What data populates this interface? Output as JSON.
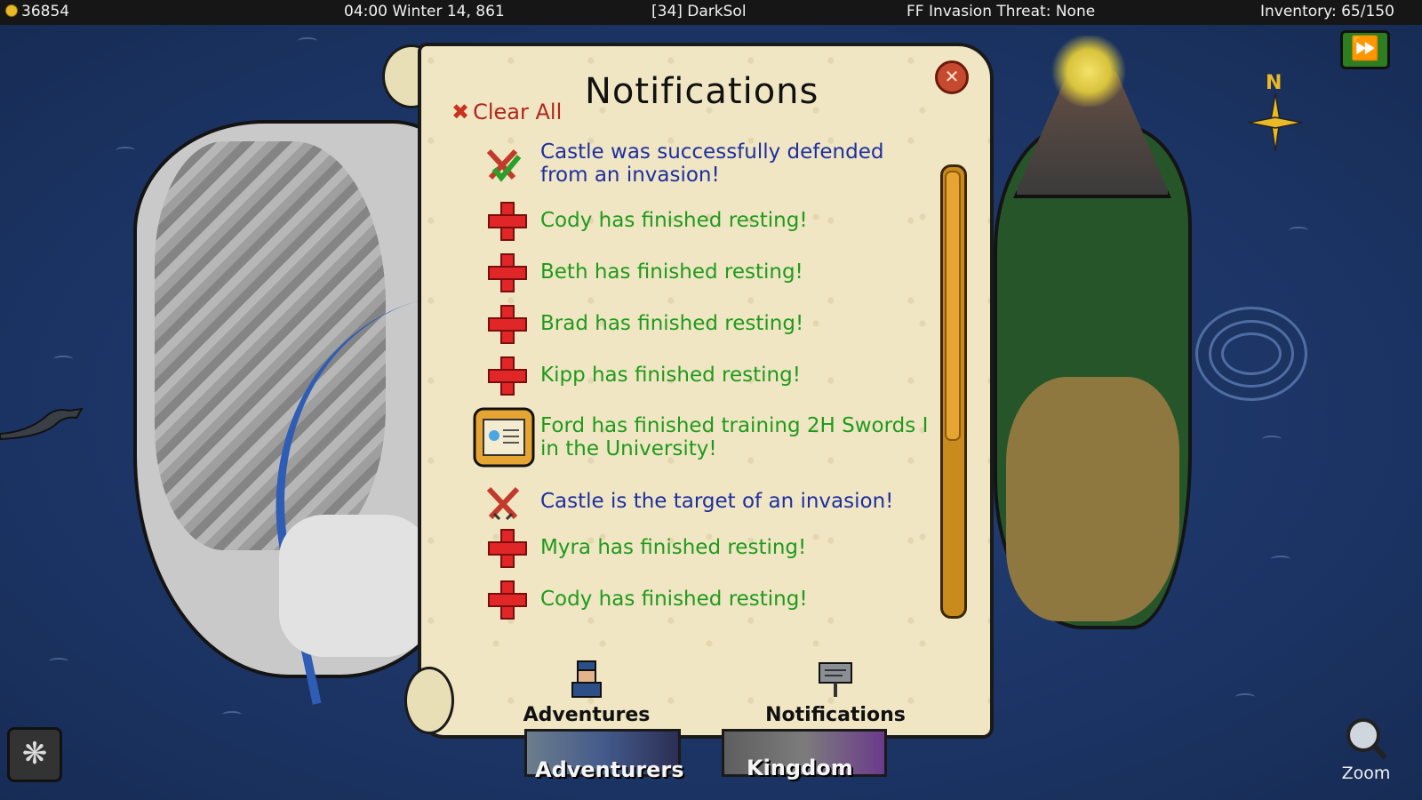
{
  "topbar": {
    "gold": "36854",
    "datetime": "04:00 Winter 14, 861",
    "player": "[34] DarkSol",
    "threat": "FF Invasion Threat: None",
    "inventory": "Inventory: 65/150"
  },
  "map": {
    "compass_label": "N"
  },
  "dialog": {
    "title": "Notifications",
    "clear_all": "Clear All",
    "notifications": [
      {
        "icon": "swords-check-icon",
        "text": "Castle was successfully defended from an invasion!",
        "color": "#1d2fa0"
      },
      {
        "icon": "red-cross-icon",
        "text": "Cody has finished resting!",
        "color": "#1f9a1c"
      },
      {
        "icon": "red-cross-icon",
        "text": "Beth has finished resting!",
        "color": "#1f9a1c"
      },
      {
        "icon": "red-cross-icon",
        "text": "Brad has finished resting!",
        "color": "#1f9a1c"
      },
      {
        "icon": "red-cross-icon",
        "text": "Kipp has finished resting!",
        "color": "#1f9a1c"
      },
      {
        "icon": "scroll-icon",
        "text": "Ford has finished training 2H Swords I in the University!",
        "color": "#1f9a1c"
      },
      {
        "icon": "crossed-swords-icon",
        "text": "Castle is the target of an invasion!",
        "color": "#1d2fa0"
      },
      {
        "icon": "red-cross-icon",
        "text": "Myra has finished resting!",
        "color": "#1f9a1c"
      },
      {
        "icon": "red-cross-icon",
        "text": "Cody has finished resting!",
        "color": "#1f9a1c"
      }
    ],
    "tabs": {
      "adventures": "Adventures",
      "notifications": "Notifications"
    }
  },
  "bottom": {
    "adventurers": "Adventurers",
    "kingdom": "Kingdom",
    "zoom": "Zoom"
  }
}
